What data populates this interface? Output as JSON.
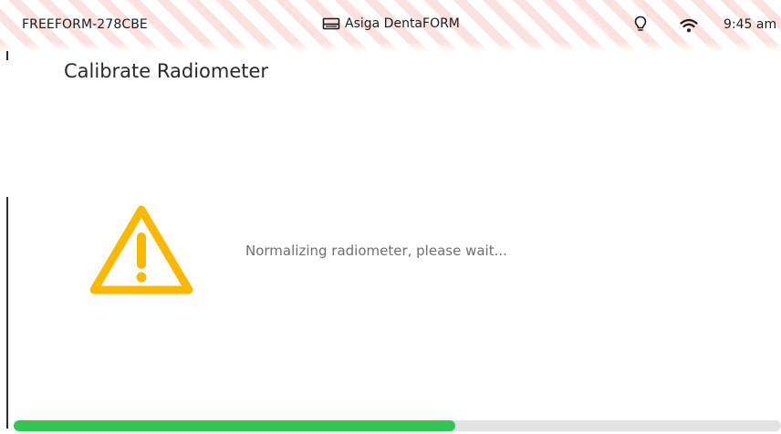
{
  "statusbar": {
    "device_id": "FREEFORM-278CBE",
    "printer_name": "Asiga DentaFORM",
    "printer_icon": "printer-icon",
    "light_icon": "lightbulb-icon",
    "wifi_icon": "wifi-icon",
    "time": "9:45 am"
  },
  "page": {
    "title": "Calibrate Radiometer",
    "message": "Normalizing radiometer, please wait...",
    "status_icon": "warning-icon"
  },
  "progress": {
    "percent": 57.5,
    "color": "#33c653",
    "track_color": "#e3e3e3"
  },
  "colors": {
    "warning": "#fbb800",
    "stripe": "#fbe2e0"
  }
}
